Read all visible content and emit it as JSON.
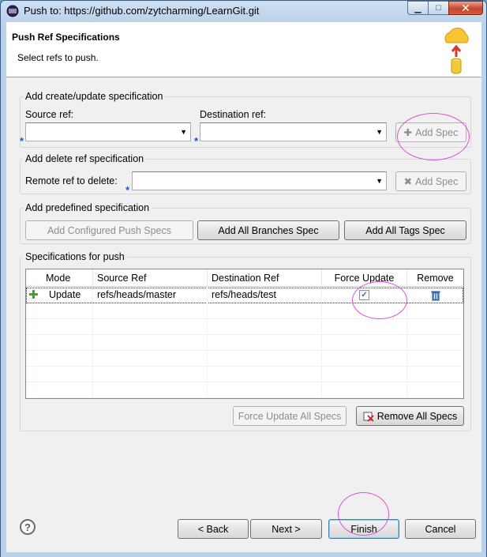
{
  "window": {
    "title": "Push to: https://github.com/zytcharming/LearnGit.git",
    "minimize": "▁",
    "maximize": "□",
    "close": "✕"
  },
  "header": {
    "title": "Push Ref Specifications",
    "description": "Select refs to push."
  },
  "update_spec": {
    "legend": "Add create/update specification",
    "source_label": "Source ref:",
    "source_value": "",
    "destination_label": "Destination ref:",
    "destination_value": "",
    "required_mark": "*",
    "add_button": "Add Spec"
  },
  "delete_spec": {
    "legend": "Add delete ref specification",
    "remote_label": "Remote ref to delete:",
    "remote_value": "",
    "add_button": "Add Spec"
  },
  "predefined": {
    "legend": "Add predefined specification",
    "configured_button": "Add Configured Push Specs",
    "branches_button": "Add All Branches Spec",
    "tags_button": "Add All Tags Spec"
  },
  "specs": {
    "legend": "Specifications for push",
    "columns": [
      "Mode",
      "Source Ref",
      "Destination Ref",
      "Force Update",
      "Remove"
    ],
    "rows": [
      {
        "mode": "Update",
        "source": "refs/heads/master",
        "destination": "refs/heads/test",
        "force_update": true
      }
    ],
    "force_all_button": "Force Update All Specs",
    "remove_all_button": "Remove All Specs"
  },
  "footer": {
    "help": "?",
    "back_button": "< Back",
    "next_button": "Next >",
    "finish_button": "Finish",
    "cancel_button": "Cancel"
  },
  "icons": {
    "add_row": "plus-icon",
    "remove_row": "trash-icon",
    "add_spec": "plus-icon",
    "delete_spec": "x-icon",
    "remove_all": "remove-all-icon",
    "header_art": "cloud-upload-icon"
  },
  "colors": {
    "required_marker": "#1a56d6",
    "annotation": "#e04ed8",
    "plus": "#3aa01e"
  }
}
